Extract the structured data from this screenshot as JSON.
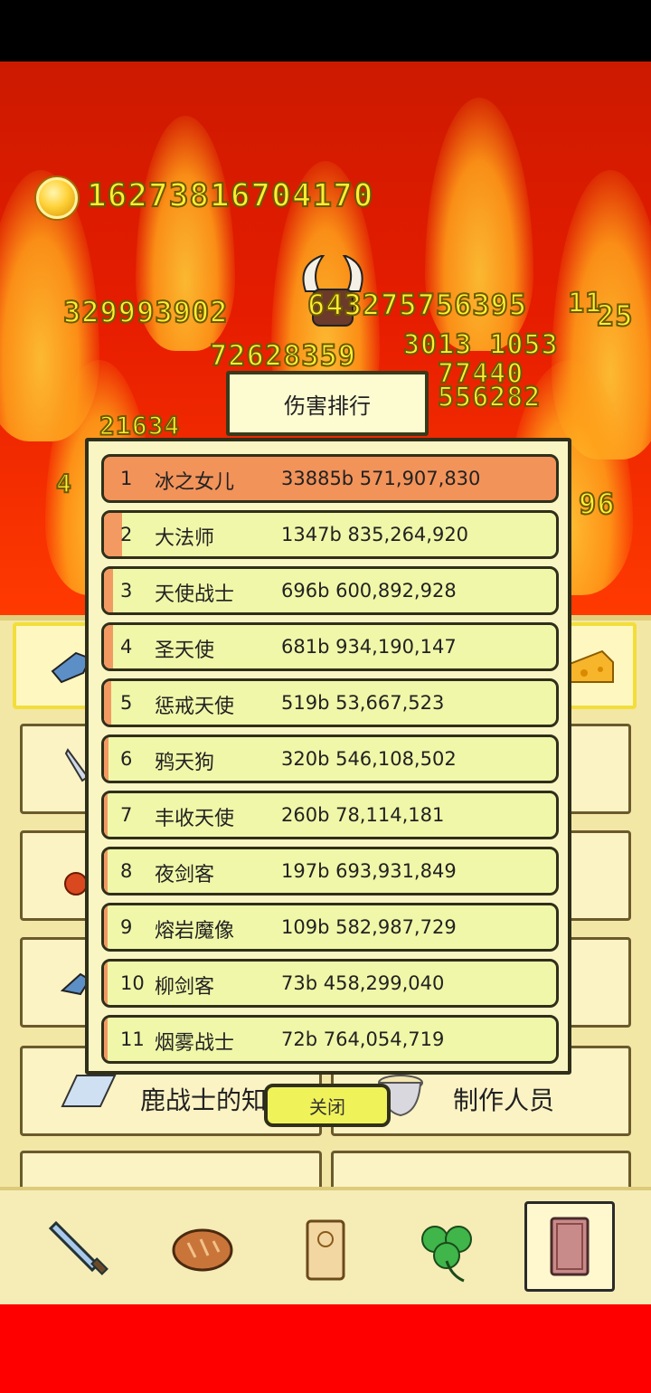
{
  "hud": {
    "gold": "16273816704170"
  },
  "damage_numbers": [
    "329993902",
    "643275756395",
    "11",
    "25",
    "72628359",
    "3013 1053",
    "77440",
    "556282",
    "21634",
    "96",
    "4"
  ],
  "ranking": {
    "title": "伤害排行",
    "close_label": "关闭",
    "rows": [
      {
        "rank": "1",
        "name": "冰之女儿",
        "value": "33885b 571,907,830",
        "share": 1.0
      },
      {
        "rank": "2",
        "name": "大法师",
        "value": "1347b 835,264,920",
        "share": 0.04
      },
      {
        "rank": "3",
        "name": "天使战士",
        "value": "696b 600,892,928",
        "share": 0.02
      },
      {
        "rank": "4",
        "name": "圣天使",
        "value": "681b 934,190,147",
        "share": 0.02
      },
      {
        "rank": "5",
        "name": "惩戒天使",
        "value": "519b 53,667,523",
        "share": 0.015
      },
      {
        "rank": "6",
        "name": "鸦天狗",
        "value": "320b 546,108,502",
        "share": 0.01
      },
      {
        "rank": "7",
        "name": "丰收天使",
        "value": "260b 78,114,181",
        "share": 0.008
      },
      {
        "rank": "8",
        "name": "夜剑客",
        "value": "197b 693,931,849",
        "share": 0.006
      },
      {
        "rank": "9",
        "name": "熔岩魔像",
        "value": "109b 582,987,729",
        "share": 0.003
      },
      {
        "rank": "10",
        "name": "柳剑客",
        "value": "73b 458,299,040",
        "share": 0.002
      },
      {
        "rank": "11",
        "name": "烟雾战士",
        "value": "72b 764,054,719",
        "share": 0.002
      }
    ]
  },
  "menu": {
    "knowledge_label": "鹿战士的知识",
    "credits_label": "制作人员"
  },
  "nav": {
    "items": [
      {
        "icon": "sword-icon"
      },
      {
        "icon": "bread-icon"
      },
      {
        "icon": "scroll-icon"
      },
      {
        "icon": "clover-icon"
      },
      {
        "icon": "book-icon",
        "active": true
      }
    ]
  },
  "colors": {
    "background_red": "#e61c00",
    "gold_text": "#ffee33",
    "row_fill": "#f0f7a8",
    "row_highlight": "#f2935a",
    "close_button": "#f0f25a"
  }
}
